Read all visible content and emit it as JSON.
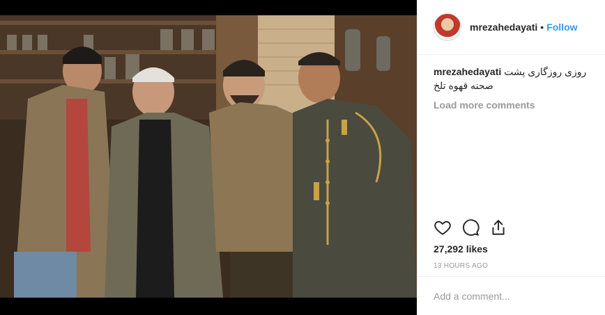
{
  "post": {
    "username": "mrezahedayati",
    "separator": "•",
    "follow_label": "Follow",
    "caption_text": "روزی روزگاری پشت صحنه قهوه تلخ",
    "load_more_label": "Load more comments",
    "likes": "27,292 likes",
    "timestamp": "13 HOURS AGO",
    "comment_placeholder": "Add a comment..."
  },
  "icons": {
    "like": "heart-icon",
    "comment": "comment-icon",
    "share": "share-icon"
  },
  "colors": {
    "follow_accent": "#3897f0",
    "muted_text": "#999999",
    "primary_text": "#262626"
  }
}
